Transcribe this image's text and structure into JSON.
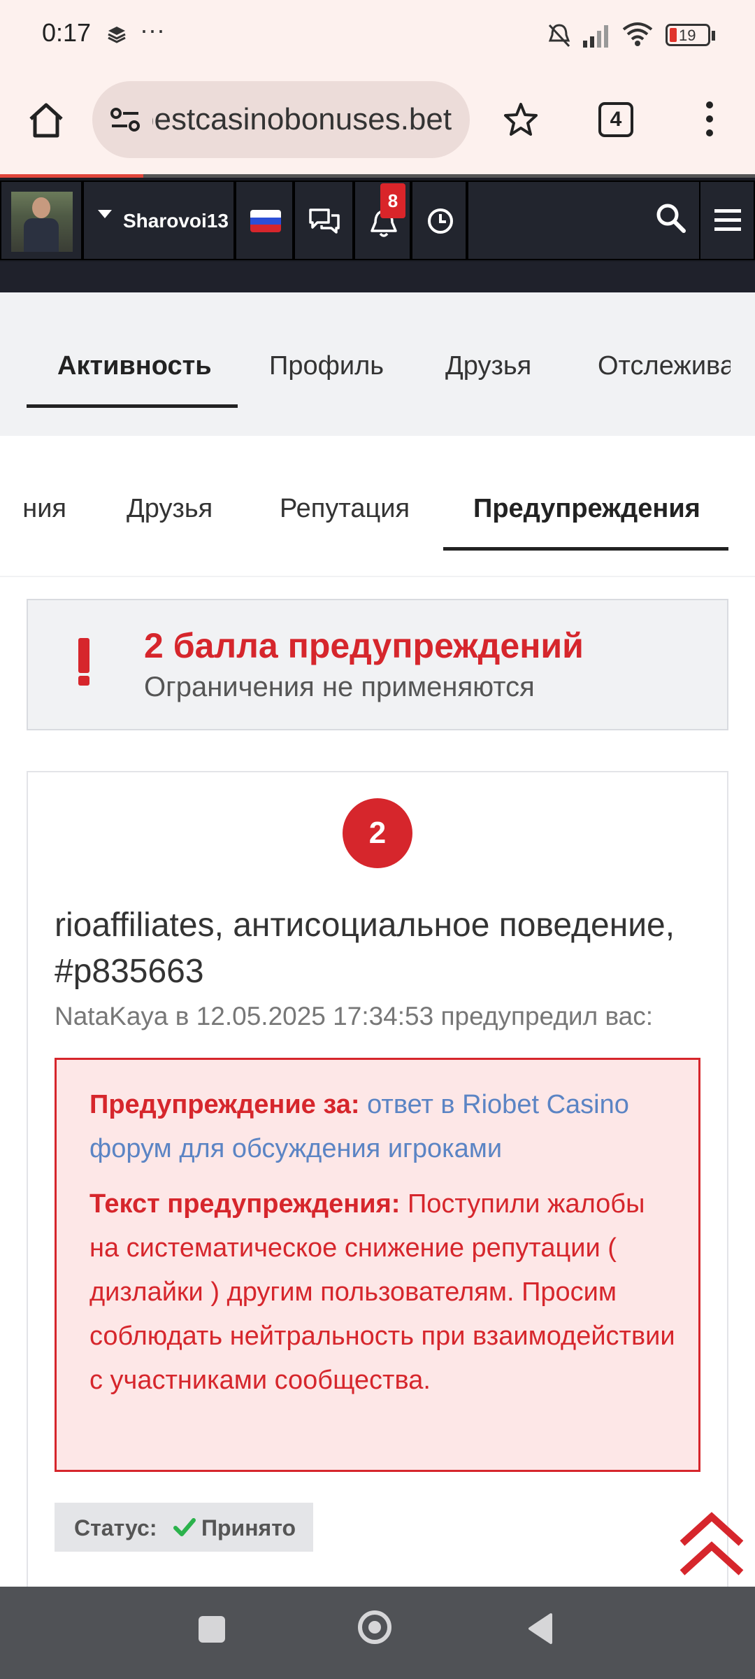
{
  "status_bar": {
    "time": "0:17",
    "battery": "19"
  },
  "browser": {
    "url": "bestcasinobonuses.bet",
    "tab_count": "4"
  },
  "site_nav": {
    "username": "Sharovoi13",
    "notifications_count": "8"
  },
  "profile_tabs": [
    {
      "label": "Активность"
    },
    {
      "label": "Профиль"
    },
    {
      "label": "Друзья"
    },
    {
      "label": "Отслежива"
    }
  ],
  "sub_tabs": [
    {
      "label": "ния"
    },
    {
      "label": "Друзья"
    },
    {
      "label": "Репутация"
    },
    {
      "label": "Предупреждения"
    }
  ],
  "alert": {
    "title": "2 балла предупреждений",
    "subtitle": "Ограничения не применяются"
  },
  "warning": {
    "points": "2",
    "author": "rioaffiliates",
    "title_rest": ", антисоциальное поведение, #p835663",
    "meta": "NataKaya в 12.05.2025 17:34:53 предупредил вас:",
    "reason_label": "Предупреждение за:",
    "reason_link": "ответ в Riobet Casino форум для обсуждения игроками",
    "text_label": "Текст предупреждения:",
    "text": "Поступили жалобы на систематическое снижение репутации ( дизлайки ) другим пользователям. Просим соблюдать нейтральность при взаимодействии с участниками сообщества.",
    "status_label": "Статус:",
    "status_value": "Принято"
  },
  "colors": {
    "accent_red": "#d6262c",
    "link_blue": "#5b84c4",
    "nav_dark": "#1b1d25",
    "ok_green": "#2bb24c"
  }
}
